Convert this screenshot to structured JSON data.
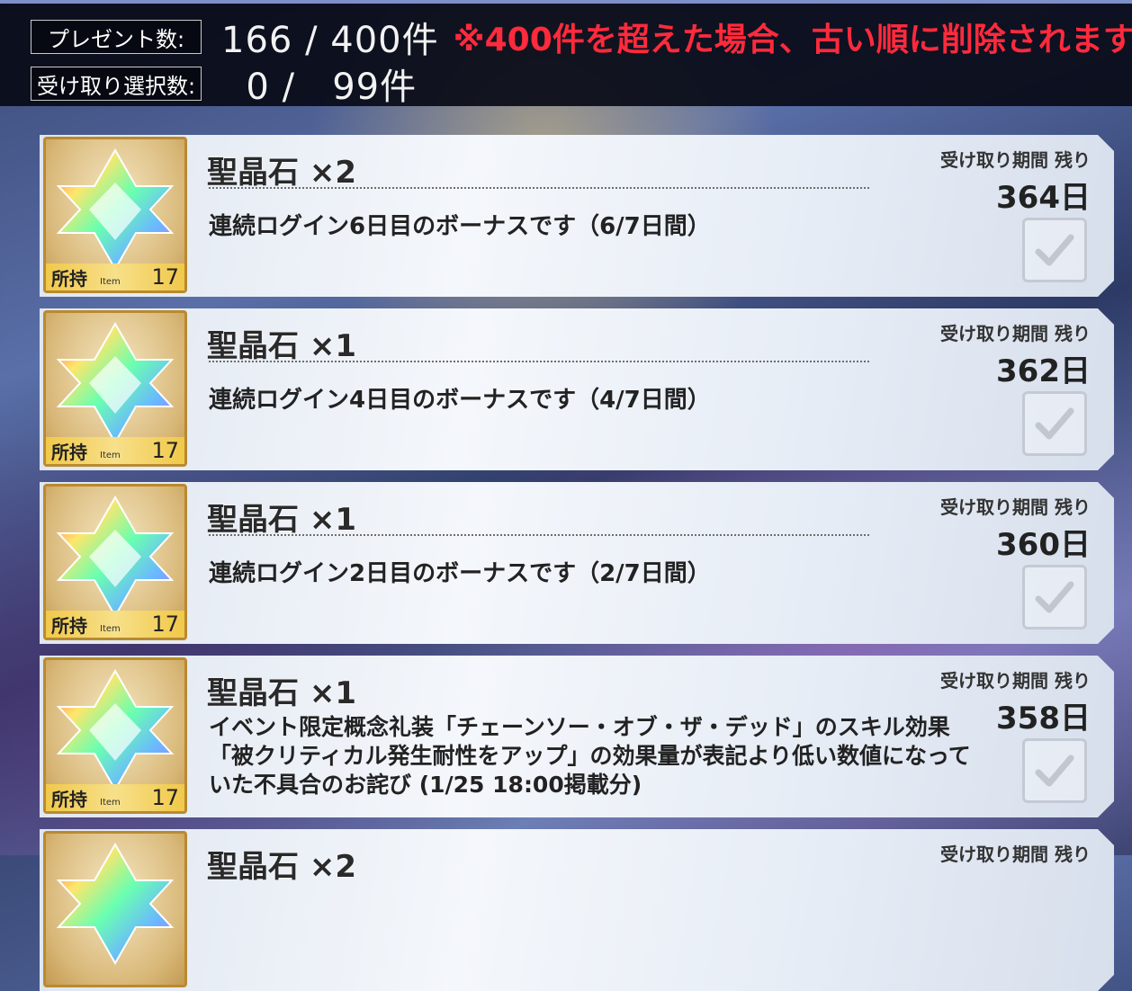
{
  "header": {
    "present_label": "プレゼント数:",
    "present_value": "166 / 400件",
    "warning": "※400件を超えた場合、古い順に削除されます",
    "selected_label": "受け取り選択数:",
    "selected_value": "  0 /   99件"
  },
  "cards": [
    {
      "title": "聖晶石 ×2",
      "description": "連続ログイン6日目のボーナスです（6/7日間）",
      "period_label": "受け取り期間 残り",
      "days": "364日",
      "owned_label": "所持",
      "owned_tag": "Item",
      "owned_count": "17"
    },
    {
      "title": "聖晶石 ×1",
      "description": "連続ログイン4日目のボーナスです（4/7日間）",
      "period_label": "受け取り期間 残り",
      "days": "362日",
      "owned_label": "所持",
      "owned_tag": "Item",
      "owned_count": "17"
    },
    {
      "title": "聖晶石 ×1",
      "description": "連続ログイン2日目のボーナスです（2/7日間）",
      "period_label": "受け取り期間 残り",
      "days": "360日",
      "owned_label": "所持",
      "owned_tag": "Item",
      "owned_count": "17"
    },
    {
      "title": "聖晶石 ×1",
      "description": "イベント限定概念礼装「チェーンソー・オブ・ザ・デッド」のスキル効果「被クリティカル発生耐性をアップ」の効果量が表記より低い数値になっていた不具合のお詫び (1/25 18:00掲載分)",
      "period_label": "受け取り期間 残り",
      "days": "358日",
      "owned_label": "所持",
      "owned_tag": "Item",
      "owned_count": "17"
    },
    {
      "title": "聖晶石 ×2",
      "period_label": "受け取り期間 残り"
    }
  ],
  "icons": {
    "item": "saint-quartz-icon",
    "checkbox": "check-icon"
  }
}
